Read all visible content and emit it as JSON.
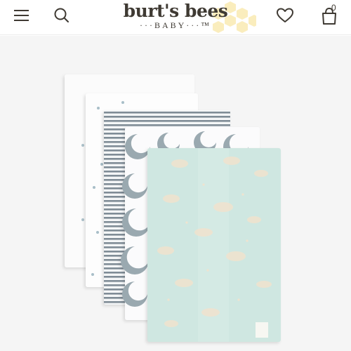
{
  "header": {
    "brand_name": "burt's bees",
    "brand_sub": "···BABY···™",
    "cart_count": "0"
  },
  "icons": {
    "menu": "hamburger-menu-icon",
    "search": "search-icon",
    "wishlist": "heart-icon",
    "cart": "shopping-bag-icon"
  },
  "product": {
    "image_subject": "set of five burp cloths",
    "colors": {
      "background": "#f5f5f5",
      "aqua_cloth": "#cfe7e1",
      "stripe": "#7f8c96",
      "moon": "#9aa9b0",
      "cloud": "#e9dcc8"
    }
  }
}
